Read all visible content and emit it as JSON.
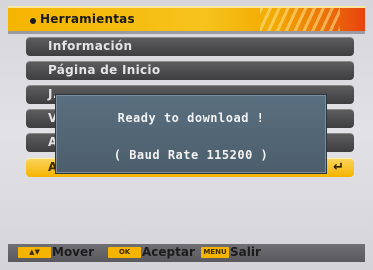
{
  "header": {
    "title": "Herramientas"
  },
  "menu": {
    "items": [
      {
        "label": "Información"
      },
      {
        "label": "Página de Inicio"
      },
      {
        "label": "J..."
      },
      {
        "label": "V"
      },
      {
        "label": "A"
      },
      {
        "label": "A"
      }
    ],
    "selected_index": 5
  },
  "dialog": {
    "line1": "Ready to download !",
    "line2": "( Baud Rate 115200 )"
  },
  "footer": {
    "move_label": "Mover",
    "ok_key": "OK",
    "accept_label": "Aceptar",
    "menu_key": "MENU",
    "exit_label": "Salir"
  },
  "colors": {
    "accent": "#f5b400",
    "item_bg": "#4a4a4c",
    "dialog_bg": "#536878"
  }
}
